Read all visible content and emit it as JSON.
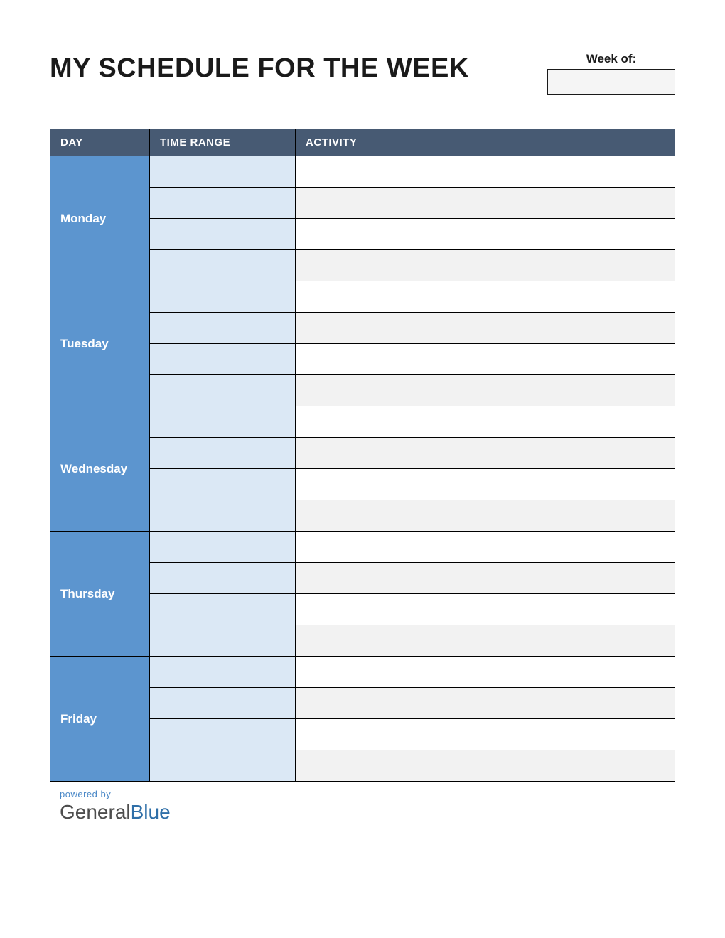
{
  "header": {
    "title": "MY SCHEDULE FOR THE WEEK",
    "week_of_label": "Week of:",
    "week_of_value": ""
  },
  "columns": {
    "day": "DAY",
    "time": "TIME RANGE",
    "activity": "ACTIVITY"
  },
  "days": [
    {
      "name": "Monday",
      "rows": [
        {
          "time": "",
          "activity": ""
        },
        {
          "time": "",
          "activity": ""
        },
        {
          "time": "",
          "activity": ""
        },
        {
          "time": "",
          "activity": ""
        }
      ]
    },
    {
      "name": "Tuesday",
      "rows": [
        {
          "time": "",
          "activity": ""
        },
        {
          "time": "",
          "activity": ""
        },
        {
          "time": "",
          "activity": ""
        },
        {
          "time": "",
          "activity": ""
        }
      ]
    },
    {
      "name": "Wednesday",
      "rows": [
        {
          "time": "",
          "activity": ""
        },
        {
          "time": "",
          "activity": ""
        },
        {
          "time": "",
          "activity": ""
        },
        {
          "time": "",
          "activity": ""
        }
      ]
    },
    {
      "name": "Thursday",
      "rows": [
        {
          "time": "",
          "activity": ""
        },
        {
          "time": "",
          "activity": ""
        },
        {
          "time": "",
          "activity": ""
        },
        {
          "time": "",
          "activity": ""
        }
      ]
    },
    {
      "name": "Friday",
      "rows": [
        {
          "time": "",
          "activity": ""
        },
        {
          "time": "",
          "activity": ""
        },
        {
          "time": "",
          "activity": ""
        },
        {
          "time": "",
          "activity": ""
        }
      ]
    }
  ],
  "footer": {
    "powered_by": "powered by",
    "logo_general": "General",
    "logo_blue": "Blue"
  }
}
